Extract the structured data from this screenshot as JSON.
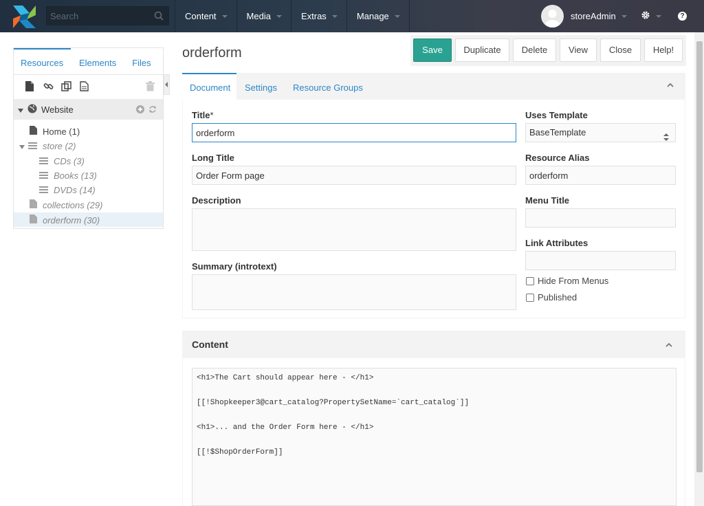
{
  "header": {
    "search_placeholder": "Search",
    "nav": [
      "Content",
      "Media",
      "Extras",
      "Manage"
    ],
    "user": "storeAdmin",
    "help_label": "?"
  },
  "tree": {
    "tabs": [
      "Resources",
      "Elements",
      "Files"
    ],
    "context": "Website",
    "nodes": {
      "home": "Home (1)",
      "store": "store (2)",
      "cds": "CDs (3)",
      "books": "Books (13)",
      "dvds": "DVDs (14)",
      "collections": "collections (29)",
      "orderform": "orderform (30)"
    }
  },
  "page": {
    "title": "orderform",
    "buttons": {
      "save": "Save",
      "duplicate": "Duplicate",
      "delete": "Delete",
      "view": "View",
      "close": "Close",
      "help": "Help!"
    }
  },
  "form": {
    "tabs": [
      "Document",
      "Settings",
      "Resource Groups"
    ],
    "title_label": "Title",
    "title_required": "*",
    "title_value": "orderform",
    "longtitle_label": "Long Title",
    "longtitle_value": "Order Form page",
    "description_label": "Description",
    "description_value": "",
    "summary_label": "Summary (introtext)",
    "summary_value": "",
    "template_label": "Uses Template",
    "template_value": "BaseTemplate",
    "alias_label": "Resource Alias",
    "alias_value": "orderform",
    "menutitle_label": "Menu Title",
    "menutitle_value": "",
    "linkattr_label": "Link Attributes",
    "linkattr_value": "",
    "hide_menus_label": "Hide From Menus",
    "published_label": "Published"
  },
  "content": {
    "heading": "Content",
    "lines": [
      "<h1>The Cart should appear here - </h1>",
      "[[!Shopkeeper3@cart_catalog?PropertySetName=`cart_catalog`]]",
      "<h1>... and the Order Form here - </h1>",
      "[[!$ShopOrderForm]]"
    ]
  },
  "colors": {
    "accent": "#2d86c6",
    "save": "#2aa291",
    "topbar": "#2c3c4c"
  }
}
